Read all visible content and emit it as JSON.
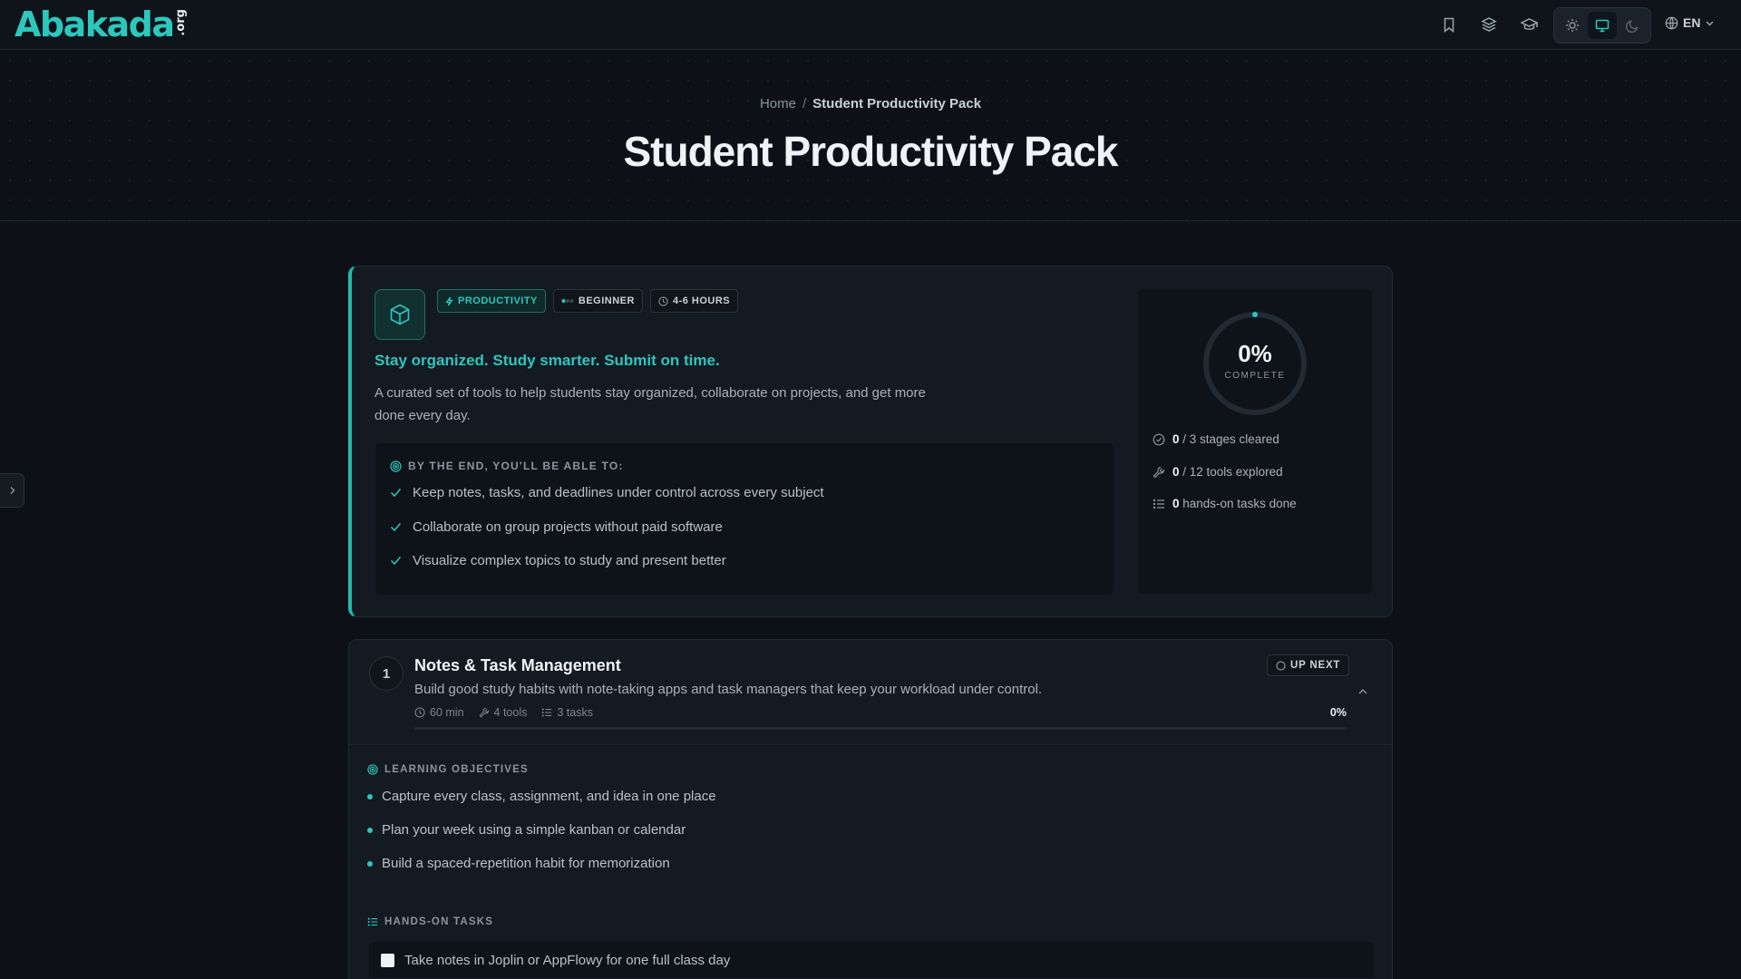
{
  "header": {
    "logo_text": "Abakada",
    "logo_suffix": ".org",
    "language": "EN",
    "icons": [
      "bookmark-icon",
      "layers-icon",
      "graduation-cap-icon",
      "sun-icon",
      "monitor-icon",
      "moon-icon",
      "globe-icon"
    ]
  },
  "hero": {
    "breadcrumb_home": "Home",
    "breadcrumb_sep": "/",
    "breadcrumb_current": "Student Productivity Pack",
    "title": "Student Productivity Pack"
  },
  "overview": {
    "tags": {
      "category": "PRODUCTIVITY",
      "level": "BEGINNER",
      "duration": "4-6 HOURS"
    },
    "tagline": "Stay organized. Study smarter. Submit on time.",
    "description": "A curated set of tools to help students stay organized, collaborate on projects, and get more done every day.",
    "outcomes_heading": "BY THE END, YOU'LL BE ABLE TO:",
    "outcomes": [
      "Keep notes, tasks, and deadlines under control across every subject",
      "Collaborate on group projects without paid software",
      "Visualize complex topics to study and present better"
    ],
    "progress": {
      "percent": "0%",
      "percent_value": 0,
      "label": "COMPLETE",
      "stages_done": "0",
      "stages_text": " / 3 stages cleared",
      "tools_done": "0",
      "tools_text": " / 12 tools explored",
      "tasks_done": "0",
      "tasks_text": " hands-on tasks done"
    }
  },
  "stage": {
    "number": "1",
    "title": "Notes & Task Management",
    "status": "UP NEXT",
    "description": "Build good study habits with note-taking apps and task managers that keep your workload under control.",
    "duration": "60 min",
    "tools": "4 tools",
    "tasks": "3 tasks",
    "percent": "0%",
    "objectives_heading": "LEARNING OBJECTIVES",
    "objectives": [
      "Capture every class, assignment, and idea in one place",
      "Plan your week using a simple kanban or calendar",
      "Build a spaced-repetition habit for memorization"
    ],
    "tasks_heading": "HANDS-ON TASKS",
    "task_items": [
      "Take notes in Joplin or AppFlowy for one full class day"
    ]
  },
  "colors": {
    "accent": "#2cc7bd",
    "background": "#0d1117",
    "card": "#141a22"
  }
}
